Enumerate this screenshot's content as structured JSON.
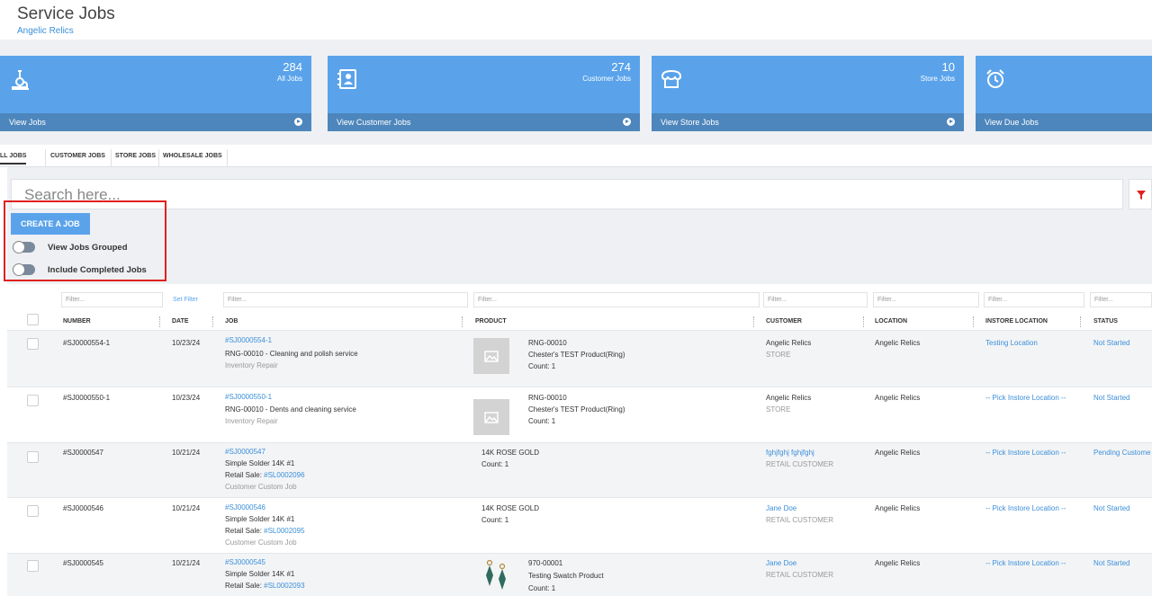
{
  "page": {
    "title": "Service Jobs",
    "subtitle": "Angelic Relics"
  },
  "tiles": [
    {
      "count": "284",
      "label": "All Jobs",
      "link": "View Jobs",
      "icon": "microscope-icon"
    },
    {
      "count": "274",
      "label": "Customer Jobs",
      "link": "View Customer Jobs",
      "icon": "contact-book-icon"
    },
    {
      "count": "10",
      "label": "Store Jobs",
      "link": "View Store Jobs",
      "icon": "store-icon"
    },
    {
      "count": "",
      "label": "",
      "link": "View Due Jobs",
      "icon": "alarm-clock-icon"
    }
  ],
  "tabs": [
    "LL JOBS",
    "CUSTOMER JOBS",
    "STORE JOBS",
    "WHOLESALE JOBS"
  ],
  "search": {
    "placeholder": "Search here..."
  },
  "actions": {
    "create": "CREATE A JOB"
  },
  "toggles": {
    "grouped": "View Jobs Grouped",
    "completed": "Include Completed Jobs"
  },
  "filters": {
    "number": "Filter...",
    "date_link": "Set Filter",
    "job": "Filter...",
    "product": "Filter...",
    "customer": "Filter...",
    "location": "Filter...",
    "instore": "Filter...",
    "status": "Filter..."
  },
  "columns": {
    "number": "NUMBER",
    "date": "DATE",
    "job": "JOB",
    "product": "PRODUCT",
    "customer": "CUSTOMER",
    "location": "LOCATION",
    "instore": "INSTORE LOCATION",
    "status": "STATUS"
  },
  "rows": [
    {
      "number": "#SJ0000554-1",
      "date": "10/23/24",
      "job_link": "#SJ0000554-1",
      "job_line": "RNG-00010 - Cleaning and polish service",
      "job_extra": "Inventory Repair",
      "product_sku": "RNG-00010",
      "product_name": "Chester's TEST Product(Ring)",
      "product_count": "Count: 1",
      "customer": "Angelic Relics",
      "customer_type": "STORE",
      "location": "Angelic Relics",
      "instore": "Testing Location",
      "status": "Not Started"
    },
    {
      "number": "#SJ0000550-1",
      "date": "10/23/24",
      "job_link": "#SJ0000550-1",
      "job_line": "RNG-00010 - Dents and cleaning service",
      "job_extra": "Inventory Repair",
      "product_sku": "RNG-00010",
      "product_name": "Chester's TEST Product(Ring)",
      "product_count": "Count: 1",
      "customer": "Angelic Relics",
      "customer_type": "STORE",
      "location": "Angelic Relics",
      "instore": "-- Pick Instore Location --",
      "status": "Not Started"
    },
    {
      "number": "#SJ0000547",
      "date": "10/21/24",
      "job_link": "#SJ0000547",
      "job_line": "Simple Solder 14K #1",
      "sale_label": "Retail Sale: ",
      "sale_link": "#SL0002096",
      "job_extra": "Customer Custom Job",
      "product_sku": "14K ROSE GOLD",
      "product_count": "Count: 1",
      "customer": "fghjfghj fghjfghj",
      "customer_type": "RETAIL CUSTOMER",
      "location": "Angelic Relics",
      "instore": "-- Pick Instore Location --",
      "status": "Pending Custome"
    },
    {
      "number": "#SJ0000546",
      "date": "10/21/24",
      "job_link": "#SJ0000546",
      "job_line": "Simple Solder 14K #1",
      "sale_label": "Retail Sale: ",
      "sale_link": "#SL0002095",
      "job_extra": "Customer Custom Job",
      "product_sku": "14K ROSE GOLD",
      "product_count": "Count: 1",
      "customer": "Jane Doe",
      "customer_type": "RETAIL CUSTOMER",
      "location": "Angelic Relics",
      "instore": "-- Pick Instore Location --",
      "status": "Not Started"
    },
    {
      "number": "#SJ0000545",
      "date": "10/21/24",
      "job_link": "#SJ0000545",
      "job_line": "Simple Solder 14K #1",
      "sale_label": "Retail Sale: ",
      "sale_link": "#SL0002093",
      "product_sku": "970-00001",
      "product_name": "Testing Swatch Product",
      "product_count": "Count: 1",
      "customer": "Jane Doe",
      "customer_type": "RETAIL CUSTOMER",
      "location": "Angelic Relics",
      "instore": "-- Pick Instore Location --",
      "status": "Not Started"
    }
  ]
}
